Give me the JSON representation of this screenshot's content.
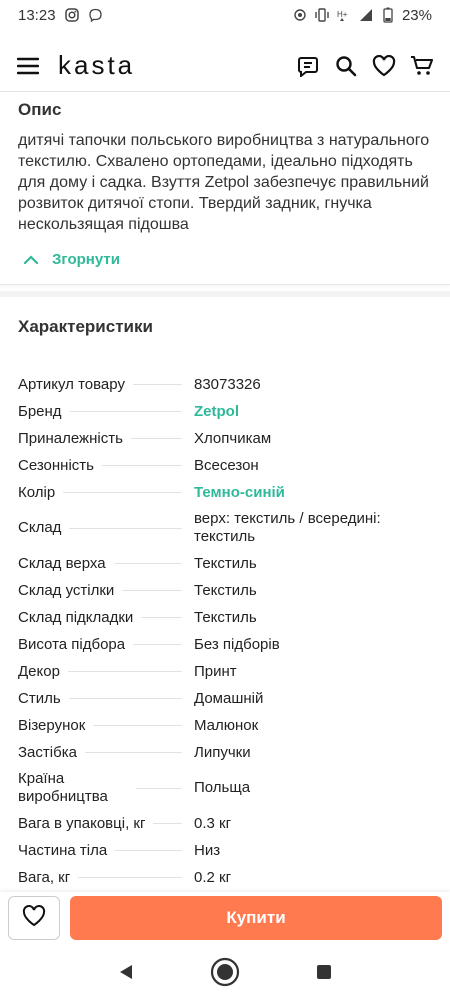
{
  "status": {
    "time": "13:23",
    "battery": "23%"
  },
  "header": {
    "logo": "kasta"
  },
  "description": {
    "title": "Опис",
    "text": "дитячі тапочки польського виробництва з натурального текстилю. Схвалено ортопедами, ідеально підходять для дому і садка. Взуття Zetpol забезпечує правильний розвиток дитячої стопи. Твердий задник, гнучка нескользящая підошва",
    "collapse_label": "Згорнути"
  },
  "characteristics": {
    "title": "Характеристики",
    "rows": [
      {
        "label": "Артикул товару",
        "value": "83073326"
      },
      {
        "label": "Бренд",
        "value": "Zetpol"
      },
      {
        "label": "Приналежність",
        "value": "Хлопчикам"
      },
      {
        "label": "Сезонність",
        "value": "Всесезон"
      },
      {
        "label": "Колір",
        "value": "Темно-синій"
      },
      {
        "label": "Склад",
        "value": "верх: текстиль / всередині: текстиль"
      },
      {
        "label": "Склад верха",
        "value": "Текстиль"
      },
      {
        "label": "Склад устілки",
        "value": "Текстиль"
      },
      {
        "label": "Склад підкладки",
        "value": "Текстиль"
      },
      {
        "label": "Висота підбора",
        "value": "Без підборів"
      },
      {
        "label": "Декор",
        "value": "Принт"
      },
      {
        "label": "Стиль",
        "value": "Домашній"
      },
      {
        "label": "Візерунок",
        "value": "Малюнок"
      },
      {
        "label": "Застібка",
        "value": "Липучки"
      },
      {
        "label": "Країна виробництва",
        "value": "Польща"
      },
      {
        "label": "Вага в упаковці, кг",
        "value": "0.3 кг"
      },
      {
        "label": "Частина тіла",
        "value": "Низ"
      },
      {
        "label": "Вага, кг",
        "value": "0.2 кг"
      }
    ]
  },
  "bottom": {
    "buy_label": "Купити"
  },
  "colors": {
    "accent": "#2fb99a",
    "buy": "#ff7a4f"
  }
}
